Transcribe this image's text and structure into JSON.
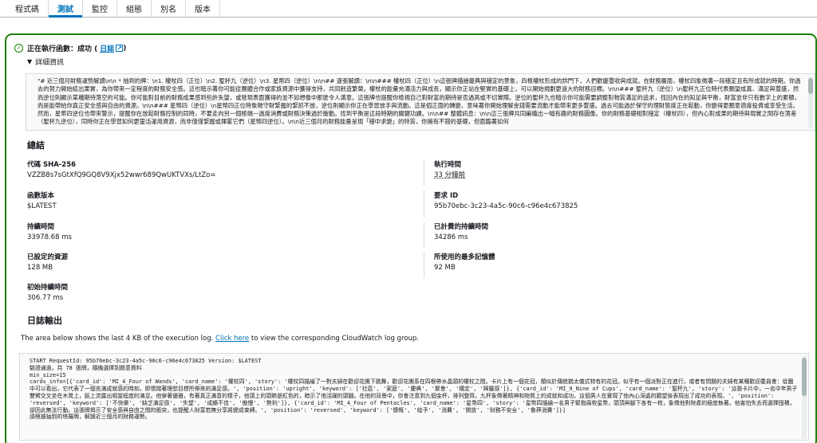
{
  "tabs": [
    {
      "label": "程式碼"
    },
    {
      "label": "測試"
    },
    {
      "label": "監控"
    },
    {
      "label": "組態"
    },
    {
      "label": "別名"
    },
    {
      "label": "版本"
    }
  ],
  "active_tab": "測試",
  "colors": {
    "success": "#1d8102",
    "link": "#0073bb",
    "border": "#d5dbdb"
  },
  "status": {
    "text": "正在執行函數：成功 (",
    "link": "日誌",
    "suffix": ")"
  },
  "details": {
    "label": "詳細資訊"
  },
  "result_text": "\"# 近三個月財務運勢解讀\\n\\n * 抽到的牌：\\n1. 權杖四（正位）\\n2. 聖杯九（逆位）\\n3. 星幣四（逆位）\\n\\n## 逐張解讀：\\n\\n### 權杖四（正位）\\n這張牌描繪慶典與穩定的景象，四根權杖形成的拱門下，人們歡慶豐收與成就。在財務層面，權杖四象徵著一段穩定且有所成就的時期。你過去的努力開始結出果實，為你帶來一定程度的財務安全感。這也暗示著你可能從團體合作或家族資源中獲得支持，共同創造繁榮。權杖的能量充滿活力與成長，顯示你正站在堅實的基礎上，可以開始規劃更遠大的財務目標。\\n\\n### 聖杯九（逆位）\\n聖杯九正位時代表願望成真、滿足與豐盛，然而逆位則顯示某種期待落空的可能。你可能對目前的財務成果感到些許失望，或發現表面獲得的並不如想像中那麼令人滿意。這張牌也提醒你檢視自己對財富的期待是否過高或不切實際。逆位的聖杯九也暗示你可能需要調整對物質滿足的追求，找回內在的知足與平衡，財富並非只有數字上的累積，而是能帶給你真正安全感與自由的資源。\\n\\n### 星幣四（逆位）\\n星幣四正位時象徵守財緊握的緊抓不放，逆位則顯示你正在學習放手與流動。這是個正面的轉變，意味著你開始理解金錢需要流動才能帶來更多豐盛。過去可能過於保守的理財態度正在鬆動，你變得更願意適度投資或享受生活。然而，星幣四逆位也帶來警示，提醒你在放鬆財務控制的同時，不要走向另一個極端—過度消費或財務決策過於衝動。找到平衡是這段時期的關鍵功課。\\n\\n## 整體訊息：\\n\\n這三張牌共同編織出一幅有趣的財務圖像。你的財務基礎相對穩定（權杖四），但內心對成果的期待與現實之間存在落差（聖杯九逆位），同時你正在學習如何更靈活運用資源，而非僅僅緊握或揮霍它們（星幣四逆位）。\\n\\n近三個月的財務能量呈現「穩中求變」的特質，你擁有不錯的基礎，但面臨著如何",
  "summary": {
    "title": "總結",
    "code_sha_label": "代碼 SHA-256",
    "code_sha_value": "VZZB8s7sGtXfQ9GQ8V9Xjx52wwr689QwUKTVXs/LtZo=",
    "exec_time_label": "執行時間",
    "exec_time_value": "33 分鐘前",
    "func_version_label": "函數版本",
    "func_version_value": "$LATEST",
    "request_id_label": "要求 ID",
    "request_id_value": "95b70ebc-3c23-4a5c-90c6-c96e4c673825",
    "duration_label": "持續時間",
    "duration_value": "33978.68 ms",
    "billed_duration_label": "已計費的持續時間",
    "billed_duration_value": "34286 ms",
    "resources_label": "已設定的資源",
    "resources_value": "128 MB",
    "max_memory_label": "所使用的最多記憶體",
    "max_memory_value": "92 MB",
    "init_duration_label": "初始持續時間",
    "init_duration_value": "306.77 ms"
  },
  "logs": {
    "title": "日誌輸出",
    "desc_prefix": "The area below shows the last 4 KB of the execution log. ",
    "desc_link": "Click here",
    "desc_suffix": " to view the corresponding CloudWatch log group.",
    "text": "START RequestId: 95b70ebc-3c23-4a5c-90c6-c96e4c673825 Version: $LATEST\n驗證通過，共 78 張牌，隨機選擇到題意資料\nmin_size=15\ncards_info=[{'card_id': 'MI_4_Four of Wands', 'card_name': '權杖四', 'story': '權杖四描繪了一對夫婦在歡迎花團下跳舞，歡迎花團系在四根帶水晶頭的權杖之間。卡片上有一個花冠，類似於傳統猶太儀式特有的花冠。似乎有一個派對正在進行，或者有問題的夫婦有某種歡迎委員會：從圖中可以看出，它代表了一個充滿成就感的時刻，即懷揣著理想目標所帶來的滿足感。', 'position': 'upright', 'keyword': ['社區', '家庭', '慶典', '聚會', '穩定', '歸屬感']}, {'card_id': 'MI_9_Nine of Cups', 'card_name': '聖杯九', 'story': '這張卡片中，一名中年男子雙臂交叉坐在木凳上，臉上流露出相當程度的滿足。他穿著優雅，有著真正滿意的樣子，他頭上的頭飾是紅色的，暗示了他活躍的頭腦。在他的背景中，你會注意到九個金杯，排列整齊。九杯象徵著精神和物質上的成就和成功，這個男人在實現了他內心深處的願望後表現出了成功的表現。', 'position': 'reversed', 'keyword': ['不快樂', '缺乏滿足感', '失望', '成績不佳', '傲慢', '勢利']}, {'card_id': 'MI_4_Four of Pentacles', 'card_name': '星幣四', 'story': '星幣四描繪一名男子緊抱兩枚星幣，頭頂與腳下各有一枚，象徵他對財產的極度執著。他害怕失去而選擇囤積，卻因此無法行動。這張牌揭示了安全感與自由之間的衝突，也提醒人財富若無分享將變成束縛。', 'position': 'reversed', 'keyword': ['慷慨', '給予', '消費', '開放', '財務不安全', '魯莽消費']}]\n請根據抽到的塔羅牌，解讀近三個月的財務運勢。"
  }
}
